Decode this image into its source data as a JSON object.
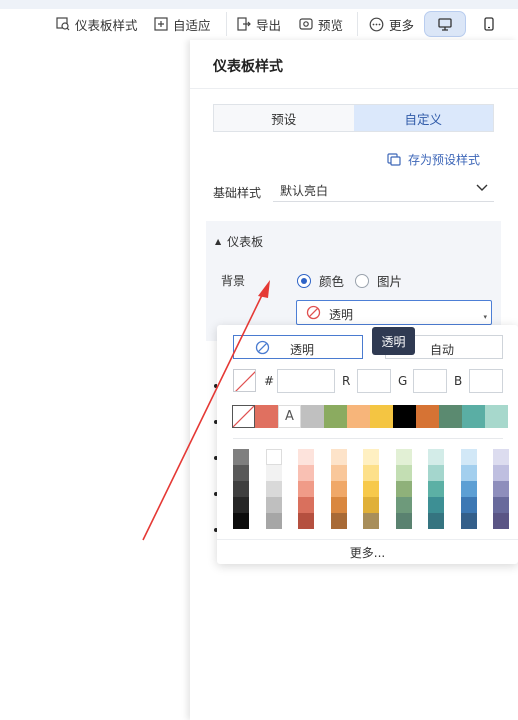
{
  "toolbar": {
    "style_label": "仪表板样式",
    "adapt_label": "自适应",
    "export_label": "导出",
    "preview_label": "预览",
    "more_label": "更多"
  },
  "panel": {
    "title": "仪表板样式",
    "tabs": [
      {
        "label": "预设"
      },
      {
        "label": "自定义"
      }
    ],
    "save_preset_label": "存为预设样式",
    "base_style": {
      "label": "基础样式",
      "value": "默认亮白"
    },
    "section": {
      "title": "仪表板",
      "background_label": "背景",
      "options": [
        {
          "label": "颜色",
          "checked": true
        },
        {
          "label": "图片",
          "checked": false
        }
      ],
      "color_value": "透明"
    }
  },
  "color_picker": {
    "transparent_label": "透明",
    "auto_label": "自动",
    "tooltip": "透明",
    "hash_label": "#",
    "r_label": "R",
    "g_label": "G",
    "b_label": "B",
    "text_swatch_label": "A",
    "quick_colors": [
      "#e07060",
      "#ffffff",
      "#c0c0c0",
      "#8bab60",
      "#f7b57a",
      "#f4c542",
      "#000000",
      "#d67334",
      "#5b8a70",
      "#5aaea4",
      "#a7d8cc"
    ],
    "palette_columns": [
      [
        "#7f7f7f",
        "#595959",
        "#3f3f3f",
        "#262626",
        "#0c0c0c"
      ],
      [
        "#ffffff",
        "#f2f2f2",
        "#d9d9d9",
        "#bfbfbf",
        "#a6a6a6"
      ],
      [
        "#fde3dc",
        "#f9c0b3",
        "#f09b88",
        "#d9705d",
        "#b5503f"
      ],
      [
        "#fde3c9",
        "#f9c79a",
        "#f0a868",
        "#d9873f",
        "#a86a36"
      ],
      [
        "#fff0c2",
        "#fde08a",
        "#f7c94b",
        "#e0b038",
        "#a88e5a"
      ],
      [
        "#e2f0d5",
        "#c3deb3",
        "#8fb17a",
        "#6e9a7b",
        "#5a8270"
      ],
      [
        "#d3ece8",
        "#a4d6cd",
        "#5cb0a5",
        "#3d8f94",
        "#357480"
      ],
      [
        "#d2e8f7",
        "#a3cfee",
        "#5d9fd4",
        "#3d78b4",
        "#345f8a"
      ],
      [
        "#dcdcef",
        "#bfbfe0",
        "#8e8ebc",
        "#686a9c",
        "#5a5585"
      ]
    ],
    "more_label": "更多..."
  }
}
